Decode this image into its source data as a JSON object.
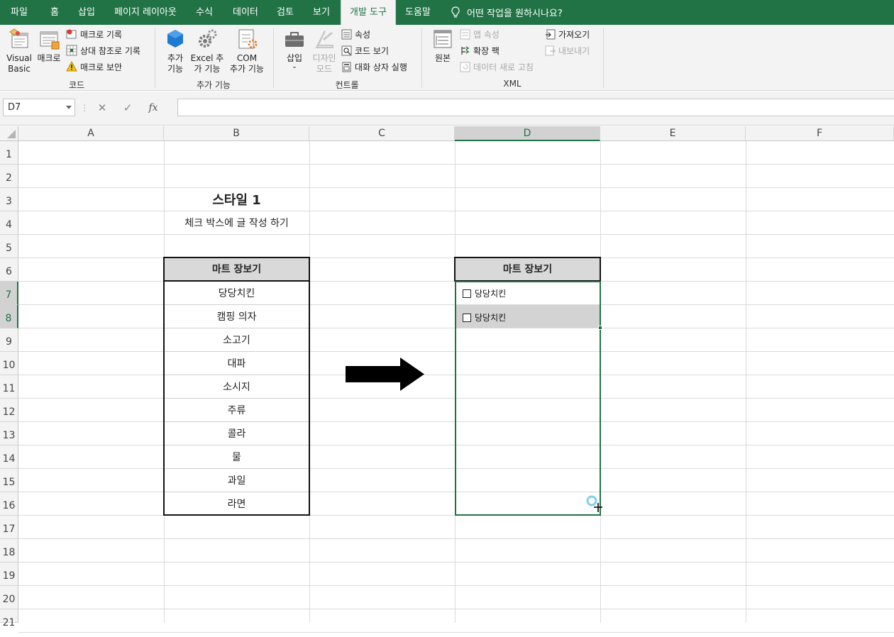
{
  "tabs": [
    "파일",
    "홈",
    "삽입",
    "페이지 레이아웃",
    "수식",
    "데이터",
    "검토",
    "보기",
    "개발 도구",
    "도움말"
  ],
  "active_tab": "개발 도구",
  "tell_me": "어떤 작업을 원하시나요?",
  "ribbon": {
    "code": {
      "label": "코드",
      "visual_basic": [
        "Visual",
        "Basic"
      ],
      "macro": "매크로",
      "record_macro": "매크로 기록",
      "relative_ref": "상대 참조로 기록",
      "macro_security": "매크로 보안"
    },
    "addins": {
      "label": "추가 기능",
      "addins_btn": [
        "추가",
        "기능"
      ],
      "excel_addins": [
        "Excel 추",
        "가 기능"
      ],
      "com_addins": [
        "COM",
        "추가 기능"
      ]
    },
    "controls": {
      "label": "컨트롤",
      "insert": "삽입",
      "design_mode": [
        "디자인",
        "모드"
      ],
      "properties": "속성",
      "view_code": "코드 보기",
      "run_dialog": "대화 상자 실행"
    },
    "xml": {
      "label": "XML",
      "source": "원본",
      "map_properties": "맵 속성",
      "expansion_packs": "확장 팩",
      "refresh_data": "데이터 새로 고침",
      "import": "가져오기",
      "export": "내보내기"
    }
  },
  "formula_bar": {
    "name_box": "D7",
    "fx": "fx",
    "formula": ""
  },
  "columns": [
    "A",
    "B",
    "C",
    "D",
    "E",
    "F"
  ],
  "selected_column": "D",
  "rows": [
    "1",
    "2",
    "3",
    "4",
    "5",
    "6",
    "7",
    "8",
    "9",
    "10",
    "11",
    "12",
    "13",
    "14",
    "15",
    "16",
    "17",
    "18",
    "19",
    "20",
    "21"
  ],
  "selected_rows": [
    "7",
    "8"
  ],
  "sheet": {
    "title": "스타일 1",
    "subtitle": "체크 박스에 글 작성 하기",
    "left_table": {
      "header": "마트 장보기",
      "items": [
        "당당치킨",
        "캠핑 의자",
        "소고기",
        "대파",
        "소시지",
        "주류",
        "콜라",
        "물",
        "과일",
        "라면"
      ]
    },
    "right_table": {
      "header": "마트 장보기",
      "checkboxes": [
        "당당치킨",
        "당당치킨"
      ]
    }
  },
  "colors": {
    "accent": "#217346",
    "header_fill": "#d9d9d9"
  }
}
